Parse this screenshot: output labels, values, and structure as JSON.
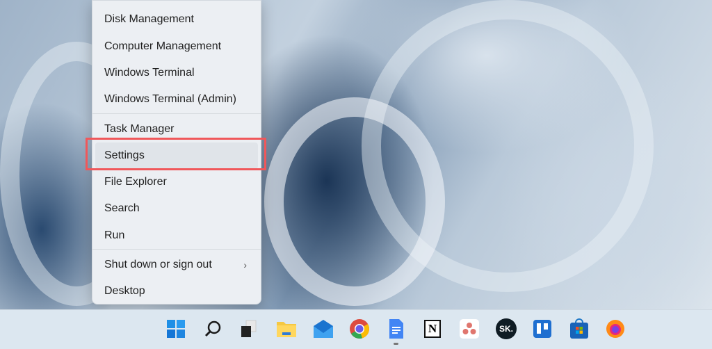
{
  "context_menu": {
    "items": [
      {
        "label": "Disk Management"
      },
      {
        "label": "Computer Management"
      },
      {
        "label": "Windows Terminal"
      },
      {
        "label": "Windows Terminal (Admin)"
      },
      {
        "label": "Task Manager"
      },
      {
        "label": "Settings",
        "highlighted": true
      },
      {
        "label": "File Explorer"
      },
      {
        "label": "Search"
      },
      {
        "label": "Run"
      },
      {
        "label": "Shut down or sign out",
        "submenu": true
      },
      {
        "label": "Desktop"
      }
    ],
    "highlight_color": "#f0575a"
  },
  "taskbar": {
    "icons": [
      "start-icon",
      "search-icon",
      "task-view-icon",
      "file-explorer-icon",
      "mail-icon",
      "chrome-icon",
      "google-docs-icon",
      "notion-icon",
      "asana-icon",
      "sk-icon",
      "trello-icon",
      "microsoft-store-icon",
      "firefox-icon"
    ],
    "sk_label": "SK.",
    "notion_label": "N"
  }
}
